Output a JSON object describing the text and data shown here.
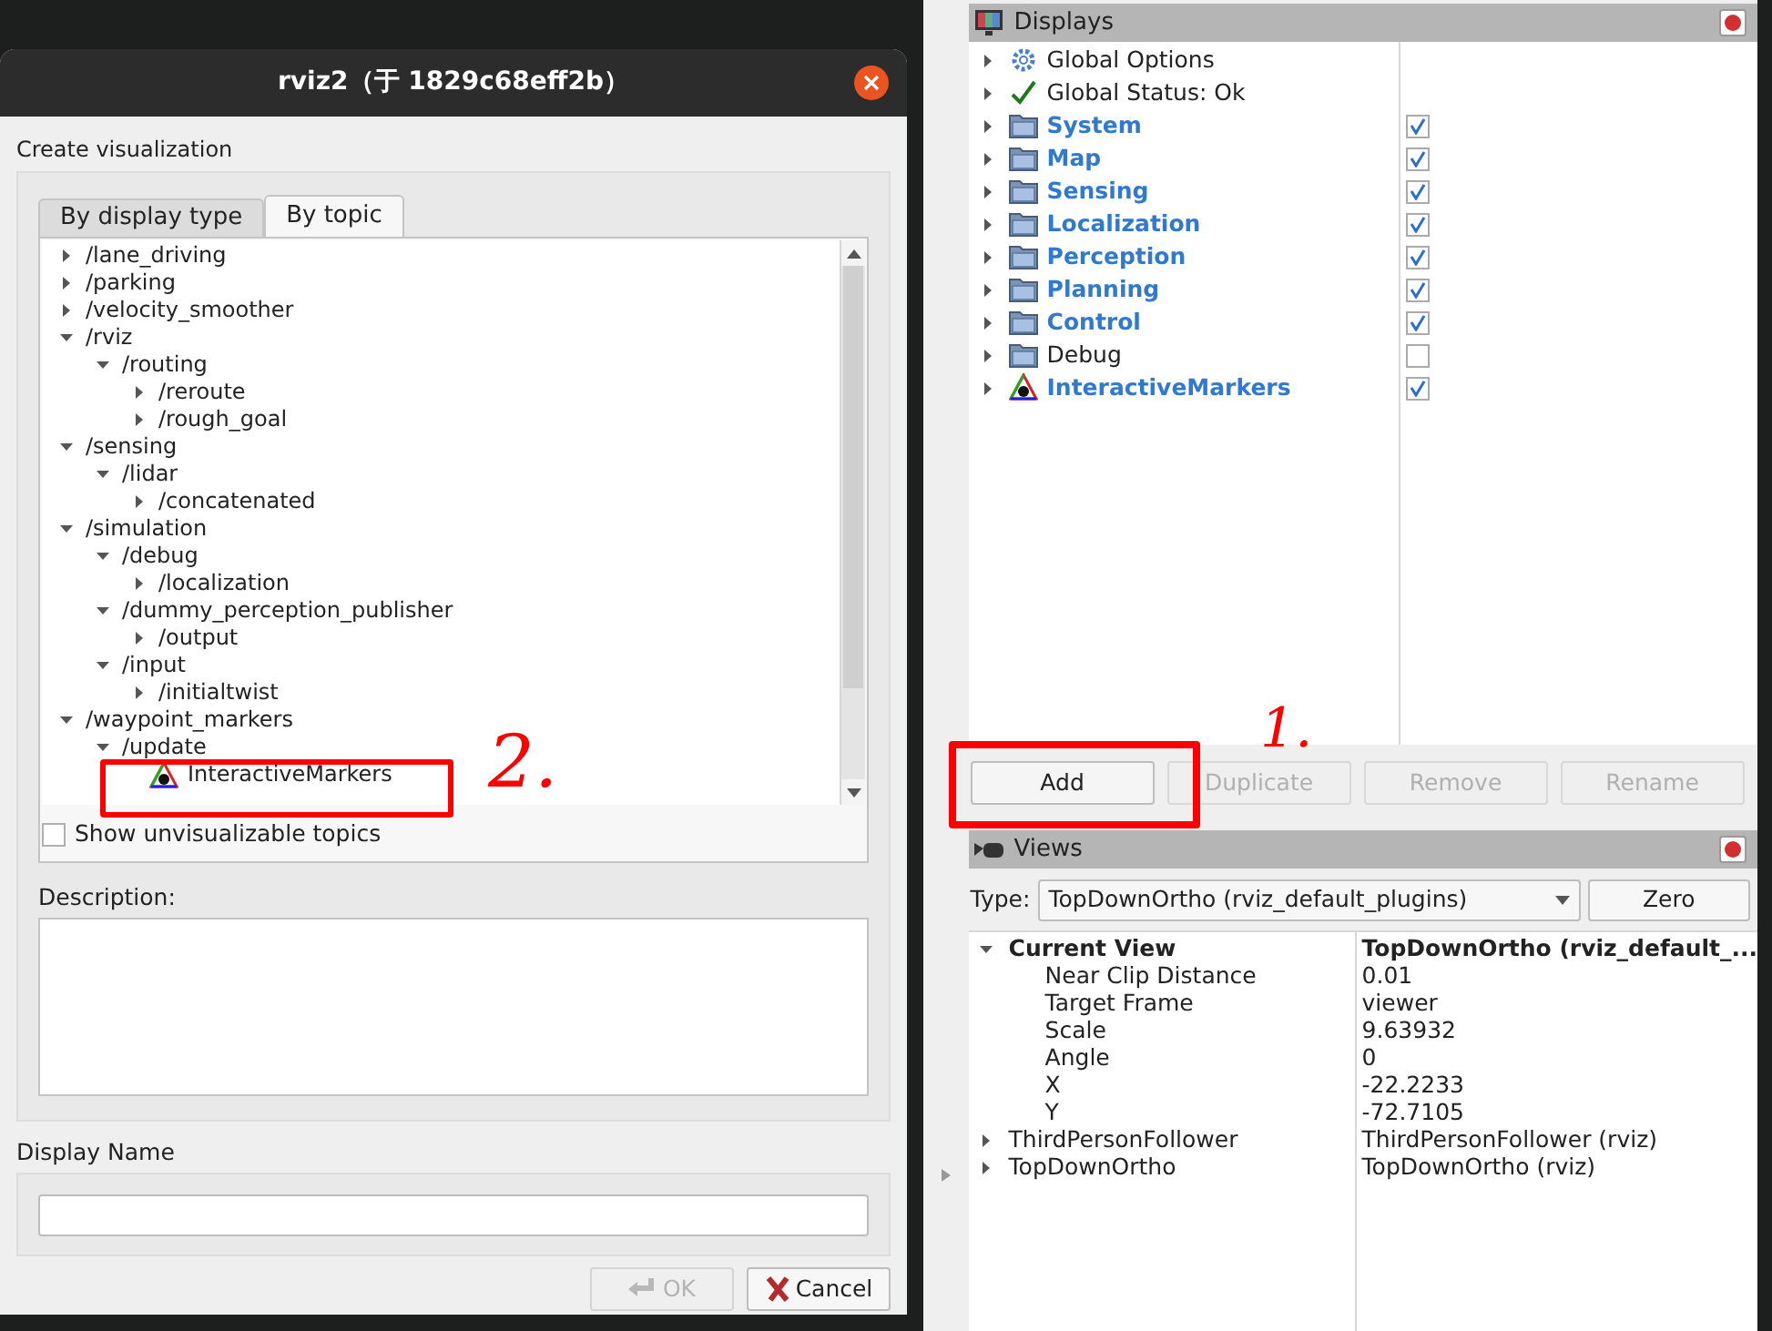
{
  "dialog": {
    "title": "rviz2（于 1829c68eff2b）",
    "heading": "Create visualization",
    "tabs": [
      {
        "label": "By display type",
        "selected": false
      },
      {
        "label": "By topic",
        "selected": true
      }
    ],
    "topic_tree": [
      {
        "children": [
          {
            "label": "/lane_driving",
            "expanded": false
          },
          {
            "label": "/parking",
            "expanded": false
          },
          {
            "label": "/velocity_smoother",
            "expanded": false
          }
        ]
      },
      {
        "label": "/rviz",
        "expanded": true,
        "children": [
          {
            "label": "/routing",
            "expanded": true,
            "children": [
              {
                "label": "/reroute",
                "expanded": false
              },
              {
                "label": "/rough_goal",
                "expanded": false
              }
            ]
          }
        ]
      },
      {
        "label": "/sensing",
        "expanded": true,
        "children": [
          {
            "label": "/lidar",
            "expanded": true,
            "children": [
              {
                "label": "/concatenated",
                "expanded": false
              }
            ]
          }
        ]
      },
      {
        "label": "/simulation",
        "expanded": true,
        "children": [
          {
            "label": "/debug",
            "expanded": true,
            "children": [
              {
                "label": "/localization",
                "expanded": false
              }
            ]
          },
          {
            "label": "/dummy_perception_publisher",
            "expanded": true,
            "children": [
              {
                "label": "/output",
                "expanded": false
              }
            ]
          },
          {
            "label": "/input",
            "expanded": true,
            "children": [
              {
                "label": "/initialtwist",
                "expanded": false
              }
            ]
          }
        ]
      },
      {
        "label": "/waypoint_markers",
        "expanded": true,
        "children": [
          {
            "label": "/update",
            "expanded": true,
            "children": [
              {
                "label": "InteractiveMarkers",
                "kind": "display"
              }
            ]
          }
        ]
      }
    ],
    "show_unvisualizable": {
      "label": "Show unvisualizable topics",
      "checked": false
    },
    "description_label": "Description:",
    "display_name_label": "Display Name",
    "buttons": [
      {
        "label": "OK",
        "kind": "ok",
        "disabled": true
      },
      {
        "label": "Cancel",
        "kind": "cancel",
        "disabled": false
      }
    ]
  },
  "displays": {
    "title": "Displays",
    "items": [
      {
        "label": "Global Options",
        "kind": "gear"
      },
      {
        "label": "Global Status: Ok",
        "kind": "check"
      },
      {
        "label": "System",
        "kind": "folder",
        "checked": true
      },
      {
        "label": "Map",
        "kind": "folder",
        "checked": true
      },
      {
        "label": "Sensing",
        "kind": "folder",
        "checked": true
      },
      {
        "label": "Localization",
        "kind": "folder",
        "checked": true
      },
      {
        "label": "Perception",
        "kind": "folder",
        "checked": true
      },
      {
        "label": "Planning",
        "kind": "folder",
        "checked": true
      },
      {
        "label": "Control",
        "kind": "folder",
        "checked": true
      },
      {
        "label": "Debug",
        "kind": "folder",
        "checked": false
      },
      {
        "label": "InteractiveMarkers",
        "kind": "markers",
        "checked": true
      }
    ],
    "buttons": [
      {
        "label": "Add",
        "disabled": false
      },
      {
        "label": "Duplicate",
        "disabled": true
      },
      {
        "label": "Remove",
        "disabled": true
      },
      {
        "label": "Rename",
        "disabled": true
      }
    ]
  },
  "views": {
    "title": "Views",
    "type_label": "Type:",
    "type_value": "TopDownOrtho (rviz_default_plugins)",
    "zero_button": "Zero",
    "rows": [
      {
        "name": "Current View",
        "value": "TopDownOrtho (rviz_default_...",
        "expanded": true,
        "children": [
          {
            "name": "Near Clip Distance",
            "value": "0.01"
          },
          {
            "name": "Target Frame",
            "value": "viewer"
          },
          {
            "name": "Scale",
            "value": "9.63932"
          },
          {
            "name": "Angle",
            "value": "0"
          },
          {
            "name": "X",
            "value": "-22.2233"
          },
          {
            "name": "Y",
            "value": "-72.7105"
          }
        ]
      },
      {
        "name": "ThirdPersonFollower",
        "value": "ThirdPersonFollower (rviz)",
        "expanded": false
      },
      {
        "name": "TopDownOrtho",
        "value": "TopDownOrtho (rviz)",
        "expanded": false
      }
    ]
  },
  "annotations": [
    {
      "label": "2."
    },
    {
      "label": "1."
    }
  ]
}
